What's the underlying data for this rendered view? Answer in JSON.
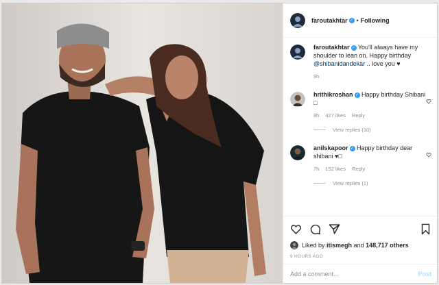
{
  "post": {
    "username": "faroutakhtar",
    "follow_label": "Following",
    "separator": "•"
  },
  "caption": {
    "username": "faroutakhtar",
    "text_1": "You'll always have my shoulder to lean on. Happy birthday",
    "mention": "@shibanidandekar",
    "text_2": ".. love you",
    "heart": "♥",
    "time": "9h"
  },
  "comments": [
    {
      "username": "hrithikroshan",
      "text": "Happy birthday Shibani",
      "emoji": "□",
      "time": "8h",
      "likes": "427 likes",
      "reply_label": "Reply",
      "view_replies": "View replies (10)"
    },
    {
      "username": "anilskapoor",
      "text": "Happy birthday dear shibani",
      "emoji": "♥□",
      "time": "7h",
      "likes": "152 likes",
      "reply_label": "Reply",
      "view_replies": "View replies (1)"
    }
  ],
  "likes": {
    "prefix": "Liked by",
    "user": "itismegh",
    "and": "and",
    "count": "148,717 others"
  },
  "timestamp": "9 HOURS AGO",
  "add_comment": {
    "placeholder": "Add a comment...",
    "post_label": "Post"
  },
  "icons": {
    "like": "heart-icon",
    "comment": "comment-icon",
    "share": "share-icon",
    "save": "bookmark-icon"
  },
  "colors": {
    "verified": "#3897f0",
    "link": "#00376b",
    "muted": "#8e8e8e",
    "post_disabled": "#b2dffc"
  }
}
